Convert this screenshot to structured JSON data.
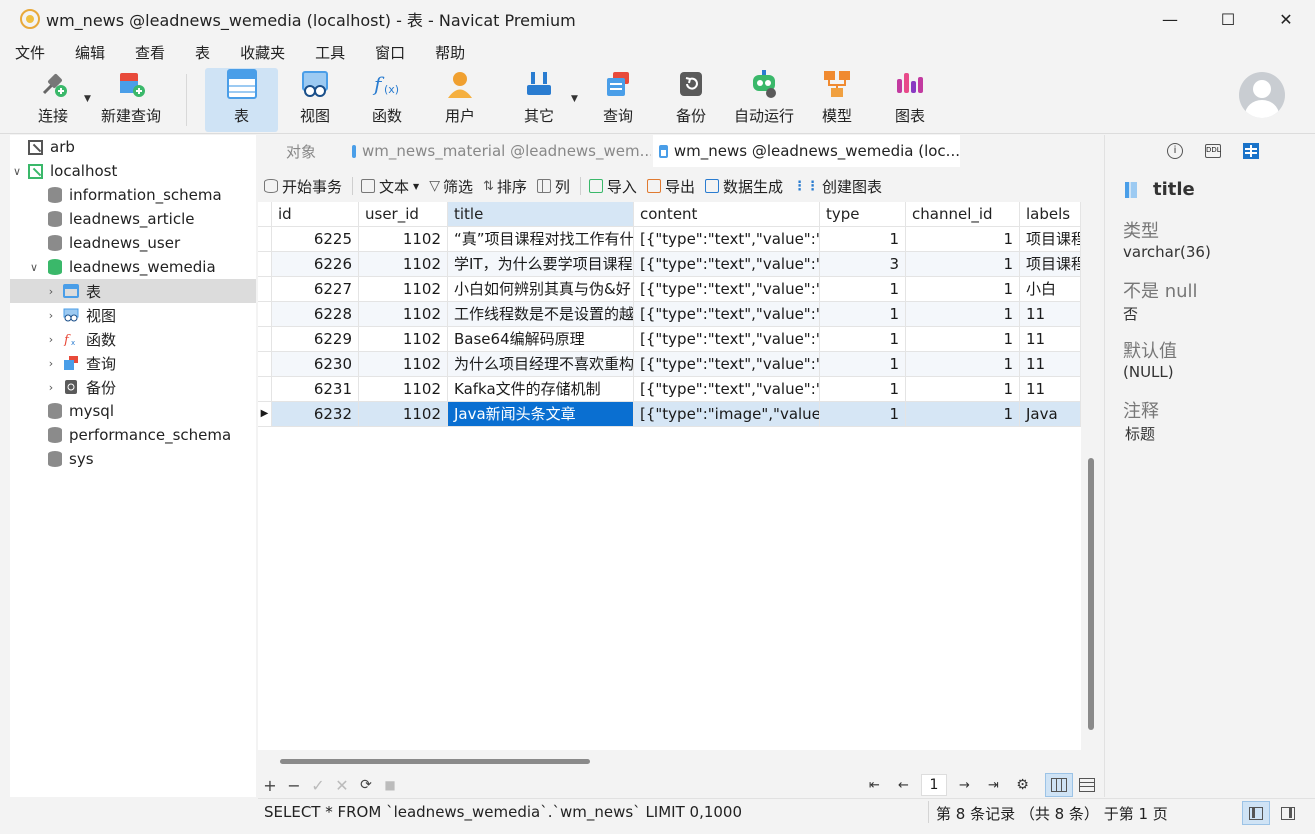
{
  "window": {
    "title": "wm_news @leadnews_wemedia (localhost) - 表 - Navicat Premium",
    "controls": [
      "minimize",
      "maximize",
      "close"
    ]
  },
  "menu": [
    "文件",
    "编辑",
    "查看",
    "表",
    "收藏夹",
    "工具",
    "窗口",
    "帮助"
  ],
  "toolbar": [
    {
      "label": "连接",
      "icon": "connection-icon"
    },
    {
      "label": "新建查询",
      "icon": "new-query-icon"
    },
    {
      "label": "表",
      "icon": "table-icon",
      "active": true
    },
    {
      "label": "视图",
      "icon": "view-icon"
    },
    {
      "label": "函数",
      "icon": "function-icon"
    },
    {
      "label": "用户",
      "icon": "user-icon"
    },
    {
      "label": "其它",
      "icon": "tools-icon"
    },
    {
      "label": "查询",
      "icon": "query-icon"
    },
    {
      "label": "备份",
      "icon": "backup-icon"
    },
    {
      "label": "自动运行",
      "icon": "robot-icon"
    },
    {
      "label": "模型",
      "icon": "model-icon"
    },
    {
      "label": "图表",
      "icon": "chart-icon"
    }
  ],
  "sidebar": {
    "items": [
      {
        "label": "arb",
        "type": "connection",
        "indent": 0
      },
      {
        "label": "localhost",
        "type": "connection-open",
        "indent": 0
      },
      {
        "label": "information_schema",
        "type": "db",
        "indent": 1
      },
      {
        "label": "leadnews_article",
        "type": "db",
        "indent": 1
      },
      {
        "label": "leadnews_user",
        "type": "db",
        "indent": 1
      },
      {
        "label": "leadnews_wemedia",
        "type": "db-open",
        "indent": 1
      },
      {
        "label": "表",
        "type": "tables",
        "indent": 2,
        "selected": true
      },
      {
        "label": "视图",
        "type": "views",
        "indent": 2
      },
      {
        "label": "函数",
        "type": "functions",
        "indent": 2
      },
      {
        "label": "查询",
        "type": "queries",
        "indent": 2
      },
      {
        "label": "备份",
        "type": "backups",
        "indent": 2
      },
      {
        "label": "mysql",
        "type": "db",
        "indent": 1
      },
      {
        "label": "performance_schema",
        "type": "db",
        "indent": 1
      },
      {
        "label": "sys",
        "type": "db",
        "indent": 1
      }
    ]
  },
  "tabs": [
    {
      "label": "对象"
    },
    {
      "label": "wm_news_material @leadnews_wem..."
    },
    {
      "label": "wm_news @leadnews_wemedia (loc...",
      "active": true
    }
  ],
  "subtoolbar": [
    "开始事务",
    "文本",
    "筛选",
    "排序",
    "列",
    "导入",
    "导出",
    "数据生成",
    "创建图表"
  ],
  "grid": {
    "columns": [
      "id",
      "user_id",
      "title",
      "content",
      "type",
      "channel_id",
      "labels"
    ],
    "rows": [
      [
        "6225",
        "1102",
        "“真”项目课程对找工作有什",
        "[{\"type\":\"text\",\"value\":\"",
        "1",
        "1",
        "项目课程"
      ],
      [
        "6226",
        "1102",
        "学IT，为什么要学项目课程",
        "[{\"type\":\"text\",\"value\":\"",
        "3",
        "1",
        "项目课程"
      ],
      [
        "6227",
        "1102",
        "小白如何辨别其真与伪&好",
        "[{\"type\":\"text\",\"value\":\"",
        "1",
        "1",
        "小白"
      ],
      [
        "6228",
        "1102",
        "工作线程数是不是设置的越",
        "[{\"type\":\"text\",\"value\":\"",
        "1",
        "1",
        "11"
      ],
      [
        "6229",
        "1102",
        "Base64编解码原理",
        "[{\"type\":\"text\",\"value\":\"",
        "1",
        "1",
        "11"
      ],
      [
        "6230",
        "1102",
        "为什么项目经理不喜欢重构",
        "[{\"type\":\"text\",\"value\":\"",
        "1",
        "1",
        "11"
      ],
      [
        "6231",
        "1102",
        "Kafka文件的存储机制",
        "[{\"type\":\"text\",\"value\":\"",
        "1",
        "1",
        "11"
      ],
      [
        "6232",
        "1102",
        "Java新闻头条文章",
        "[{\"type\":\"image\",\"value\"",
        "1",
        "1",
        "Java"
      ]
    ],
    "current_row": 7
  },
  "bottom": {
    "page": "1"
  },
  "status": {
    "sql": "SELECT * FROM `leadnews_wemedia`.`wm_news` LIMIT 0,1000",
    "records": "第 8 条记录 （共 8 条） 于第 1 页"
  },
  "panel": {
    "field": "title",
    "type_label": "类型",
    "type_value": "varchar(36)",
    "notnull_label": "不是 null",
    "notnull_value": "否",
    "default_label": "默认值",
    "default_value": "(NULL)",
    "comment_label": "注释",
    "comment_value": "标题"
  },
  "colors": {
    "accent": "#0a6fd1",
    "selection": "#d6e6f5",
    "db_active": "#3ab86a"
  }
}
